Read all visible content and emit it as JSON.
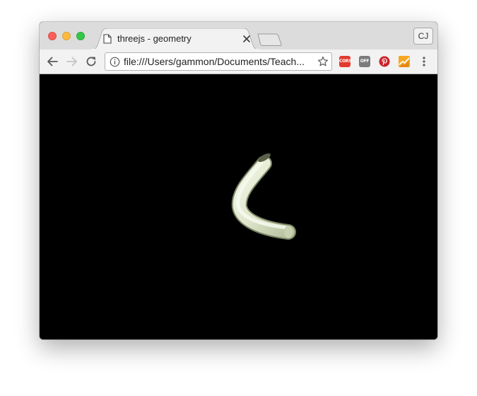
{
  "tab": {
    "title": "threejs - geometry",
    "favicon": "page-icon",
    "close_icon": "close-icon"
  },
  "profile": {
    "initials": "CJ"
  },
  "toolbar": {
    "back_icon": "back-arrow-icon",
    "forward_icon": "forward-arrow-icon",
    "reload_icon": "reload-icon",
    "url": "file:///Users/gammon/Documents/Teach...",
    "info_icon": "info-icon",
    "bookmark_icon": "star-icon",
    "menu_icon": "kebab-menu-icon"
  },
  "extensions": [
    {
      "name": "cors-extension-icon",
      "label": "CORS",
      "color": "#e33a2f"
    },
    {
      "name": "off-extension-icon",
      "label": "OFF",
      "color": "#7b7b7b"
    },
    {
      "name": "pinterest-icon",
      "label": "",
      "color": "#cb2027"
    },
    {
      "name": "chart-extension-icon",
      "label": "",
      "color": "#f39c12"
    }
  ],
  "scene": {
    "background": "#000000",
    "object": "curved-tube-mesh",
    "object_color": "#e3ead4"
  },
  "colors": {
    "traffic_close": "#fc605c",
    "traffic_minimize": "#fdbc40",
    "traffic_maximize": "#34c84a"
  }
}
